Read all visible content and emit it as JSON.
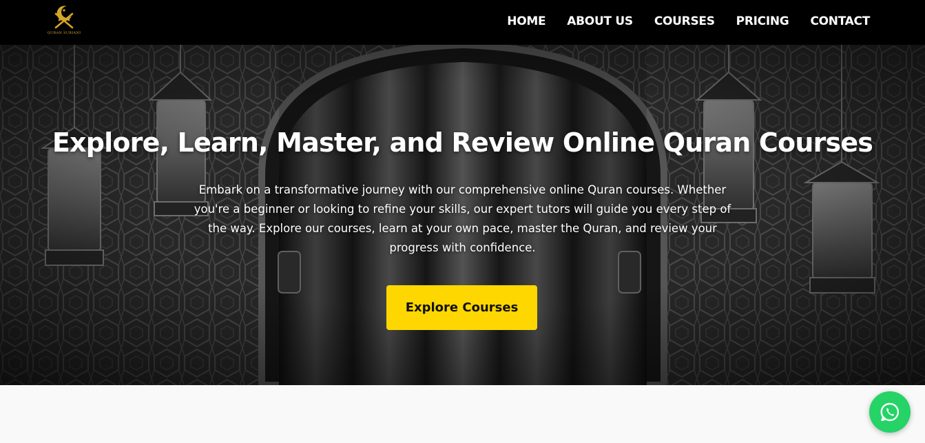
{
  "brand": {
    "logo_text": "QURAN SUBIANI",
    "logo_icon": "crescent-quran-stand-icon",
    "accent_color": "#d4a62a"
  },
  "nav": {
    "items": [
      {
        "label": "HOME"
      },
      {
        "label": "ABOUT US"
      },
      {
        "label": "COURSES"
      },
      {
        "label": "PRICING"
      },
      {
        "label": "CONTACT"
      }
    ]
  },
  "hero": {
    "title": "Explore, Learn, Master, and Review Online Quran Courses",
    "description": "Embark on a transformative journey with our comprehensive online Quran courses. Whether you're a beginner or looking to refine your skills, our expert tutors will guide you every step of the way. Explore our courses, learn at your own pace, master the Quran, and review your progress with confidence.",
    "cta_label": "Explore Courses",
    "cta_color": "#ffd700",
    "background": "black-and-white arch with curtains and hanging lanterns"
  },
  "whatsapp": {
    "icon": "whatsapp-icon",
    "color": "#25d366"
  }
}
